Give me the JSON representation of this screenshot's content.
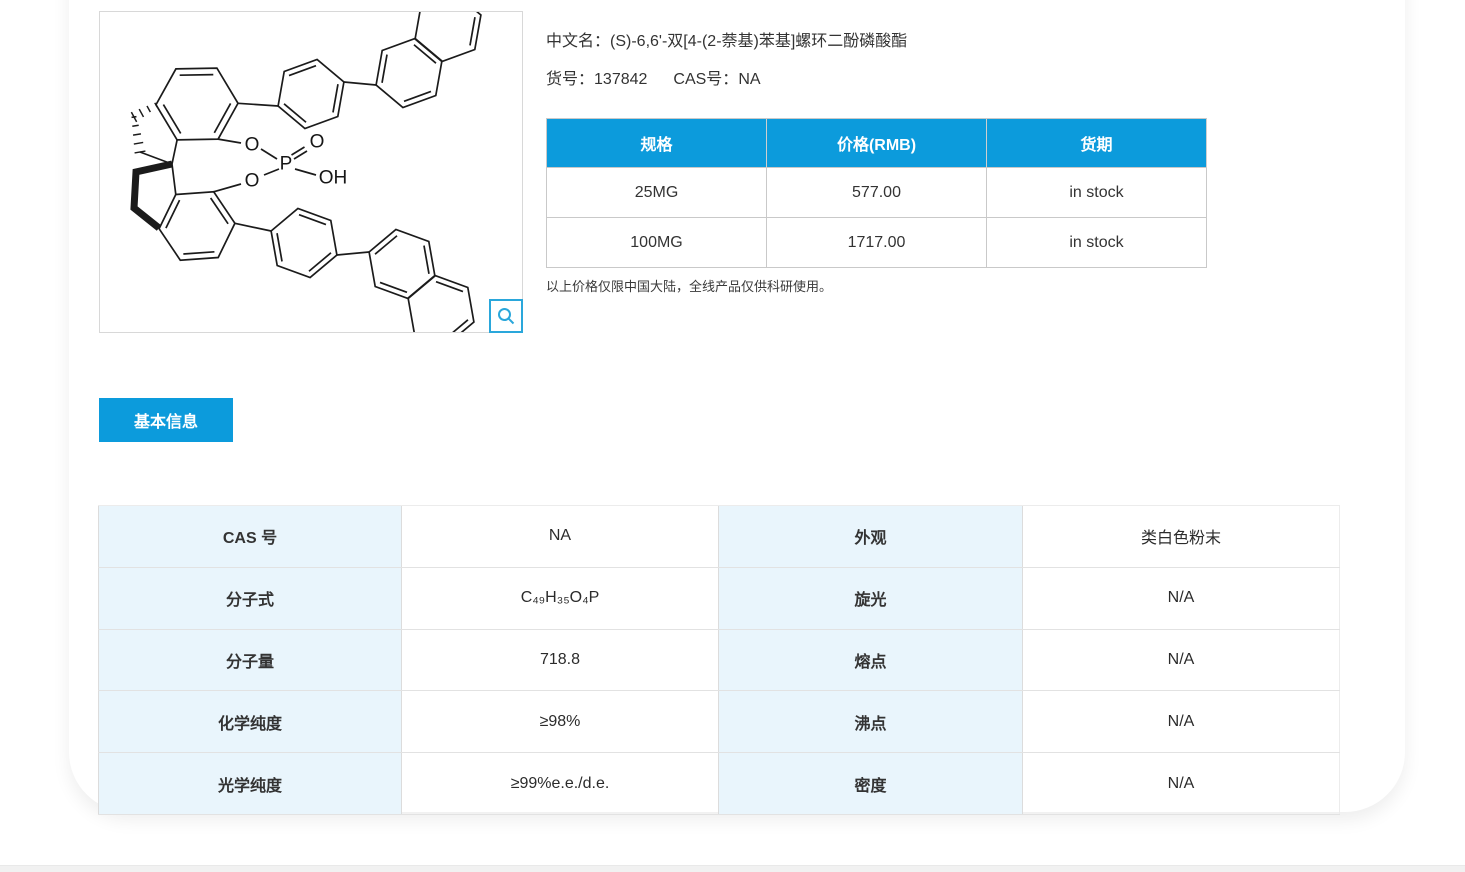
{
  "product": {
    "name_label": "中文名：",
    "name": "(S)-6,6'-双[4-(2-萘基)苯基]螺环二酚磷酸酯",
    "sku_label": "货号：",
    "sku": "137842",
    "cas_label": "CAS号：",
    "cas": "NA"
  },
  "price_table": {
    "headers": [
      "规格",
      "价格(RMB)",
      "货期"
    ],
    "rows": [
      [
        "25MG",
        "577.00",
        "in stock"
      ],
      [
        "100MG",
        "1717.00",
        "in stock"
      ]
    ],
    "note": "以上价格仅限中国大陆，全线产品仅供科研使用。"
  },
  "tabs": {
    "basic_info": "基本信息"
  },
  "properties": {
    "rows": [
      [
        "CAS 号",
        "NA",
        "外观",
        "类白色粉末"
      ],
      [
        "分子式",
        "C₄₉H₃₅O₄P",
        "旋光",
        "N/A"
      ],
      [
        "分子量",
        "718.8",
        "熔点",
        "N/A"
      ],
      [
        "化学纯度",
        "≥98%",
        "沸点",
        "N/A"
      ],
      [
        "光学纯度",
        "≥99%e.e./d.e.",
        "密度",
        "N/A"
      ]
    ]
  },
  "molecule": {
    "labels": {
      "o_top": "O",
      "o_double": "O",
      "p": "P",
      "oh": "OH",
      "o_bottom": "O"
    }
  },
  "colors": {
    "accent": "#0c9bdc",
    "label_cell_bg": "#e9f5fc"
  }
}
